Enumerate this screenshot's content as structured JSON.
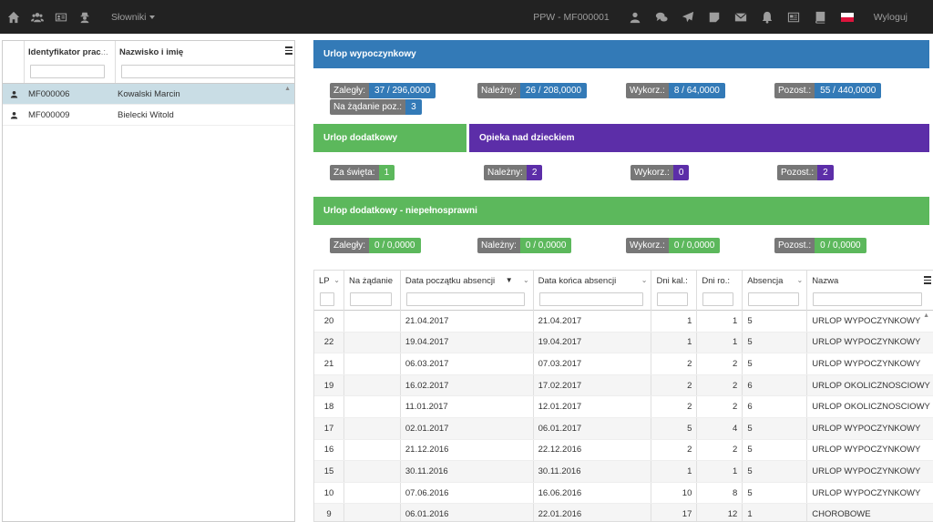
{
  "navbar": {
    "dropdown_label": "Słowniki",
    "title": "PPW - MF000001",
    "logout_label": "Wyloguj",
    "icons_left": [
      "home-icon",
      "users-icon",
      "id-card-icon",
      "user-secret-icon"
    ],
    "icons_right": [
      "user-icon",
      "chat-icon",
      "send-icon",
      "note-icon",
      "envelope-icon",
      "bell-icon",
      "report-icon",
      "book-icon"
    ]
  },
  "employees": {
    "columns": [
      "Identyfikator prac",
      "Nazwisko i imię"
    ],
    "rows": [
      {
        "id": "MF000006",
        "name": "Kowalski Marcin",
        "selected": true
      },
      {
        "id": "MF000009",
        "name": "Bielecki Witold",
        "selected": false
      }
    ]
  },
  "urlop_wypoczynkowy": {
    "title": "Urlop wypoczynkowy",
    "zalegly_k": "Zaległy:",
    "zalegly_v": "37 / 296,0000",
    "nalezny_k": "Należny:",
    "nalezny_v": "26 / 208,0000",
    "wykorz_k": "Wykorz.:",
    "wykorz_v": "8 / 64,0000",
    "pozost_k": "Pozost.:",
    "pozost_v": "55 / 440,0000",
    "nazadanie_k": "Na żądanie poz.:",
    "nazadanie_v": "3"
  },
  "urlop_dodatkowy": {
    "title": "Urlop dodatkowy",
    "zaswieta_k": "Za święta:",
    "zaswieta_v": "1"
  },
  "opieka": {
    "title": "Opieka nad dzieckiem",
    "nalezny_k": "Należny:",
    "nalezny_v": "2",
    "wykorz_k": "Wykorz.:",
    "wykorz_v": "0",
    "pozost_k": "Pozost.:",
    "pozost_v": "2"
  },
  "niepelnosprawni": {
    "title": "Urlop dodatkowy - niepełnosprawni",
    "zalegly_k": "Zaległy:",
    "zalegly_v": "0 / 0,0000",
    "nalezny_k": "Należny:",
    "nalezny_v": "0 / 0,0000",
    "wykorz_k": "Wykorz.:",
    "wykorz_v": "0 / 0,0000",
    "pozost_k": "Pozost.:",
    "pozost_v": "0 / 0,0000"
  },
  "absences": {
    "columns": [
      "LP",
      "Na żądanie",
      "Data początku absencji",
      "Data końca absencji",
      "Dni kal",
      "Dni ro",
      "Absencja",
      "Nazwa"
    ],
    "rows": [
      [
        "20",
        "",
        "21.04.2017",
        "21.04.2017",
        "1",
        "1",
        "5",
        "URLOP WYPOCZYNKOWY"
      ],
      [
        "22",
        "",
        "19.04.2017",
        "19.04.2017",
        "1",
        "1",
        "5",
        "URLOP WYPOCZYNKOWY"
      ],
      [
        "21",
        "",
        "06.03.2017",
        "07.03.2017",
        "2",
        "2",
        "5",
        "URLOP WYPOCZYNKOWY"
      ],
      [
        "19",
        "",
        "16.02.2017",
        "17.02.2017",
        "2",
        "2",
        "6",
        "URLOP OKOLICZNOSCIOWY"
      ],
      [
        "18",
        "",
        "11.01.2017",
        "12.01.2017",
        "2",
        "2",
        "6",
        "URLOP OKOLICZNOSCIOWY"
      ],
      [
        "17",
        "",
        "02.01.2017",
        "06.01.2017",
        "5",
        "4",
        "5",
        "URLOP WYPOCZYNKOWY"
      ],
      [
        "16",
        "",
        "21.12.2016",
        "22.12.2016",
        "2",
        "2",
        "5",
        "URLOP WYPOCZYNKOWY"
      ],
      [
        "15",
        "",
        "30.11.2016",
        "30.11.2016",
        "1",
        "1",
        "5",
        "URLOP WYPOCZYNKOWY"
      ],
      [
        "10",
        "",
        "07.06.2016",
        "16.06.2016",
        "10",
        "8",
        "5",
        "URLOP WYPOCZYNKOWY"
      ],
      [
        "9",
        "",
        "06.01.2016",
        "22.01.2016",
        "17",
        "12",
        "1",
        "CHOROBOWE"
      ]
    ]
  }
}
